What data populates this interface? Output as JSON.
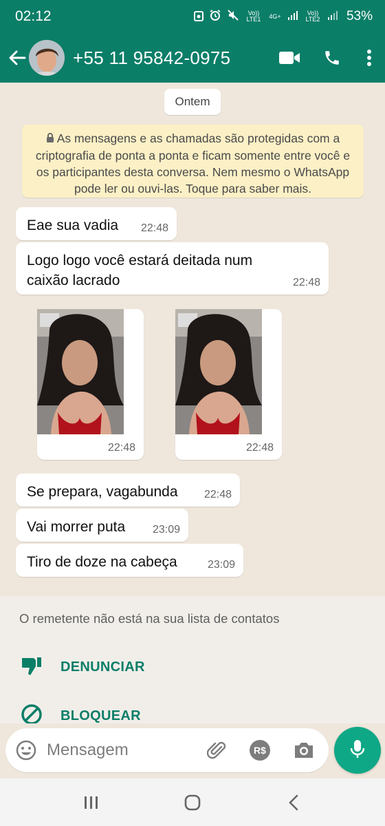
{
  "status": {
    "time": "02:12",
    "sim1": "Vo)) LTE1",
    "net": "4G+",
    "sim2": "Vo)) LTE2",
    "battery": "53%"
  },
  "header": {
    "contact": "+55 11 95842-0975",
    "icons": [
      "back-arrow-icon",
      "avatar",
      "video-call-icon",
      "phone-icon",
      "more-vert-icon"
    ]
  },
  "chat": {
    "date_chip": "Ontem",
    "encryption_notice": "As mensagens e as chamadas são protegidas com a criptografia de ponta a ponta e ficam somente entre você e os participantes desta conversa. Nem mesmo o WhatsApp pode ler ou ouvi-las. Toque para saber mais.",
    "messages": [
      {
        "text": "Eae sua vadia",
        "time": "22:48"
      },
      {
        "text": "Logo logo você estará deitada num caixão lacrado",
        "time": "22:48"
      },
      {
        "text": "Se prepara, vagabunda",
        "time": "22:48"
      },
      {
        "text": "Vai morrer puta",
        "time": "23:09"
      },
      {
        "text": "Tiro de doze na cabeça",
        "time": "23:09"
      }
    ],
    "media": [
      {
        "time": "22:48"
      },
      {
        "time": "22:48"
      }
    ]
  },
  "unknown_contact": {
    "notice": "O remetente não está na sua lista de contatos",
    "report_label": "DENUNCIAR",
    "block_label": "BLOQUEAR"
  },
  "composer": {
    "placeholder": "Mensagem",
    "pay_label": "R$"
  },
  "colors": {
    "brand": "#0b7e68",
    "accent": "#0fa886",
    "chat_bg": "#efe7dc",
    "notice_bg": "#fcf0c6"
  }
}
